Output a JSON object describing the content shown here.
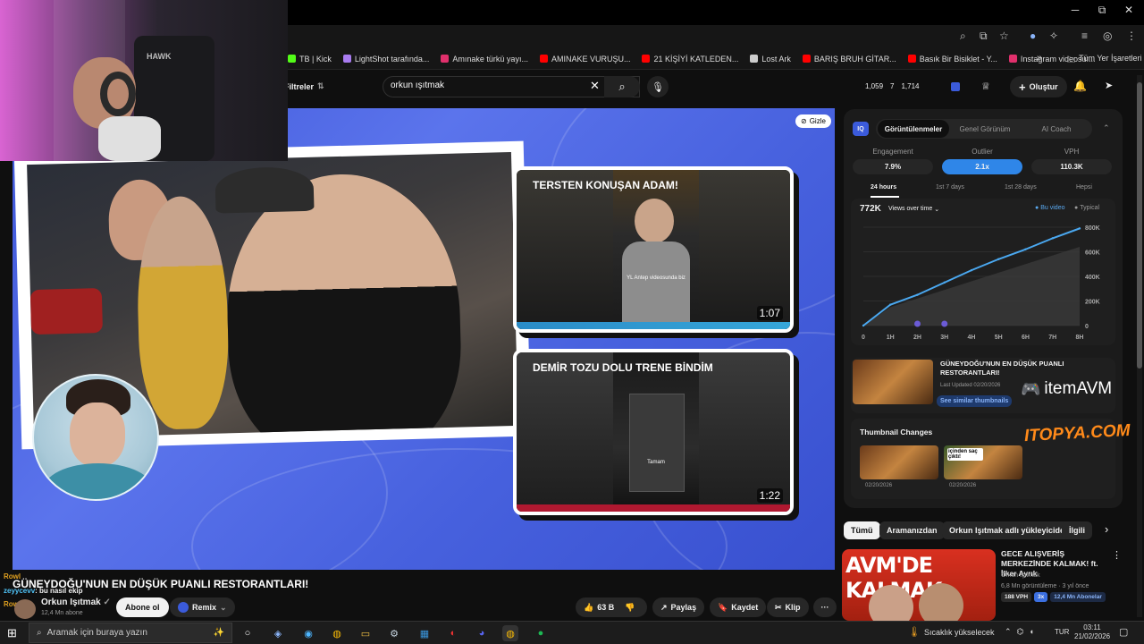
{
  "window": {
    "min": "─",
    "max": "⧉",
    "close": "✕"
  },
  "bookmarks": [
    {
      "label": "TB | Kick",
      "color": "#53fc18"
    },
    {
      "label": "LightShot tarafında...",
      "color": "#a97cf0"
    },
    {
      "label": "Amınake türkü yayı...",
      "color": "#e1306c"
    },
    {
      "label": "AMINAKE VURUŞU...",
      "color": "#ff0000"
    },
    {
      "label": "21 KİŞİYİ KATLEDEN...",
      "color": "#ff0000"
    },
    {
      "label": "Lost Ark",
      "color": "#cccccc"
    },
    {
      "label": "BARIŞ BRUH GİTAR...",
      "color": "#ff0000"
    },
    {
      "label": "Basık Bir Bisiklet - Y...",
      "color": "#ff0000"
    },
    {
      "label": "Instagram videosu:...",
      "color": "#e1306c"
    }
  ],
  "bookmarks_more": "»",
  "bookmarks_all": "Tüm Yer İşaretleri",
  "yt": {
    "filters": "Filtreler",
    "search_value": "orkun ışıtmak",
    "stats": [
      "1,059",
      "7",
      "1,714"
    ],
    "create": "Oluştur"
  },
  "webcam_brand": "HAWK",
  "player": {
    "hide": "Gizle",
    "card1": {
      "title": "TERSTEN KONUŞAN ADAM!",
      "dur": "1:07",
      "caption": "YL Antep videosunda biz"
    },
    "card2": {
      "title": "DEMİR TOZU DOLU TRENE BİNDİM",
      "dur": "1:22",
      "caption": "Tamam"
    }
  },
  "video": {
    "title": "GÜNEYDOĞU'NUN EN DÜŞÜK PUANLI RESTORANTLARI!",
    "channel": "Orkun Işıtmak",
    "subs": "12,4 Mn abone",
    "subscribe": "Abone ol",
    "remix": "Remix",
    "likes": "63 B",
    "share": "Paylaş",
    "save": "Kaydet",
    "clip": "Klip",
    "more": "···"
  },
  "chat": [
    {
      "user": "Rowl",
      "msg": "",
      "color": "#e0a020"
    },
    {
      "user": "zeyycevv",
      "msg": ": bu nasıl ekip",
      "color": "#4fc3f7"
    },
    {
      "user": "Rowl",
      "msg": "",
      "color": "#e0a020"
    }
  ],
  "panel": {
    "tabs": [
      "Görüntülenmeler",
      "Genel Görünüm",
      "AI Coach"
    ],
    "metrics": [
      {
        "label": "Engagement",
        "value": "7.9%"
      },
      {
        "label": "Outlier",
        "value": "2.1x"
      },
      {
        "label": "VPH",
        "value": "110.3K"
      }
    ],
    "ranges": [
      "24 hours",
      "1st 7 days",
      "1st 28 days",
      "Hepsi"
    ],
    "views": "772K",
    "views_mode": "Views over time",
    "legend": [
      "Bu video",
      "Typical"
    ],
    "related_title": "GÜNEYDOĞU'NUN EN DÜŞÜK PUANLI RESTORANTLARI!",
    "last_updated": "Last Updated 02/20/2026",
    "see_similar": "See similar thumbnails",
    "thumb_changes": "Thumbnail Changes",
    "thumb_dates": [
      "02/20/2026",
      "02/20/2026"
    ],
    "thumb_caption": "içinden saç çıktı!"
  },
  "chart_data": {
    "type": "area",
    "x": [
      "0",
      "1H",
      "2H",
      "3H",
      "4H",
      "5H",
      "6H",
      "7H",
      "8H"
    ],
    "series": [
      {
        "name": "Bu video",
        "values": [
          0,
          170000,
          250000,
          350000,
          450000,
          540000,
          620000,
          710000,
          790000
        ]
      },
      {
        "name": "Typical",
        "values": [
          0,
          150000,
          220000,
          290000,
          360000,
          430000,
          500000,
          570000,
          640000
        ]
      }
    ],
    "yticks": [
      "0",
      "200K",
      "400K",
      "600K",
      "800K"
    ],
    "ylim": [
      0,
      800000
    ]
  },
  "ads": {
    "itemavm": "itemAVM",
    "itopya": "ITOPYA.COM"
  },
  "filters": [
    "Tümü",
    "Aramanızdan",
    "Orkun Işıtmak adlı yükleyiciden",
    "İlgili"
  ],
  "reco": {
    "title": "GECE ALIŞVERİŞ MERKEZİNDE KALMAK! ft. İlker Ayrık",
    "channel": "Orkun Işıtmak",
    "meta": "6,8 Mn görüntüleme · 3 yıl önce",
    "vph": "188 VPH",
    "mult": "3x",
    "subs": "12,4 Mn Abonelar",
    "thumb_text": "AVM'DE KALMAK"
  },
  "taskbar": {
    "search": "Aramak için buraya yazın",
    "weather": "Sıcaklık yükselecek",
    "lang": "TUR",
    "time": "03:11",
    "date": "21/02/2026"
  }
}
